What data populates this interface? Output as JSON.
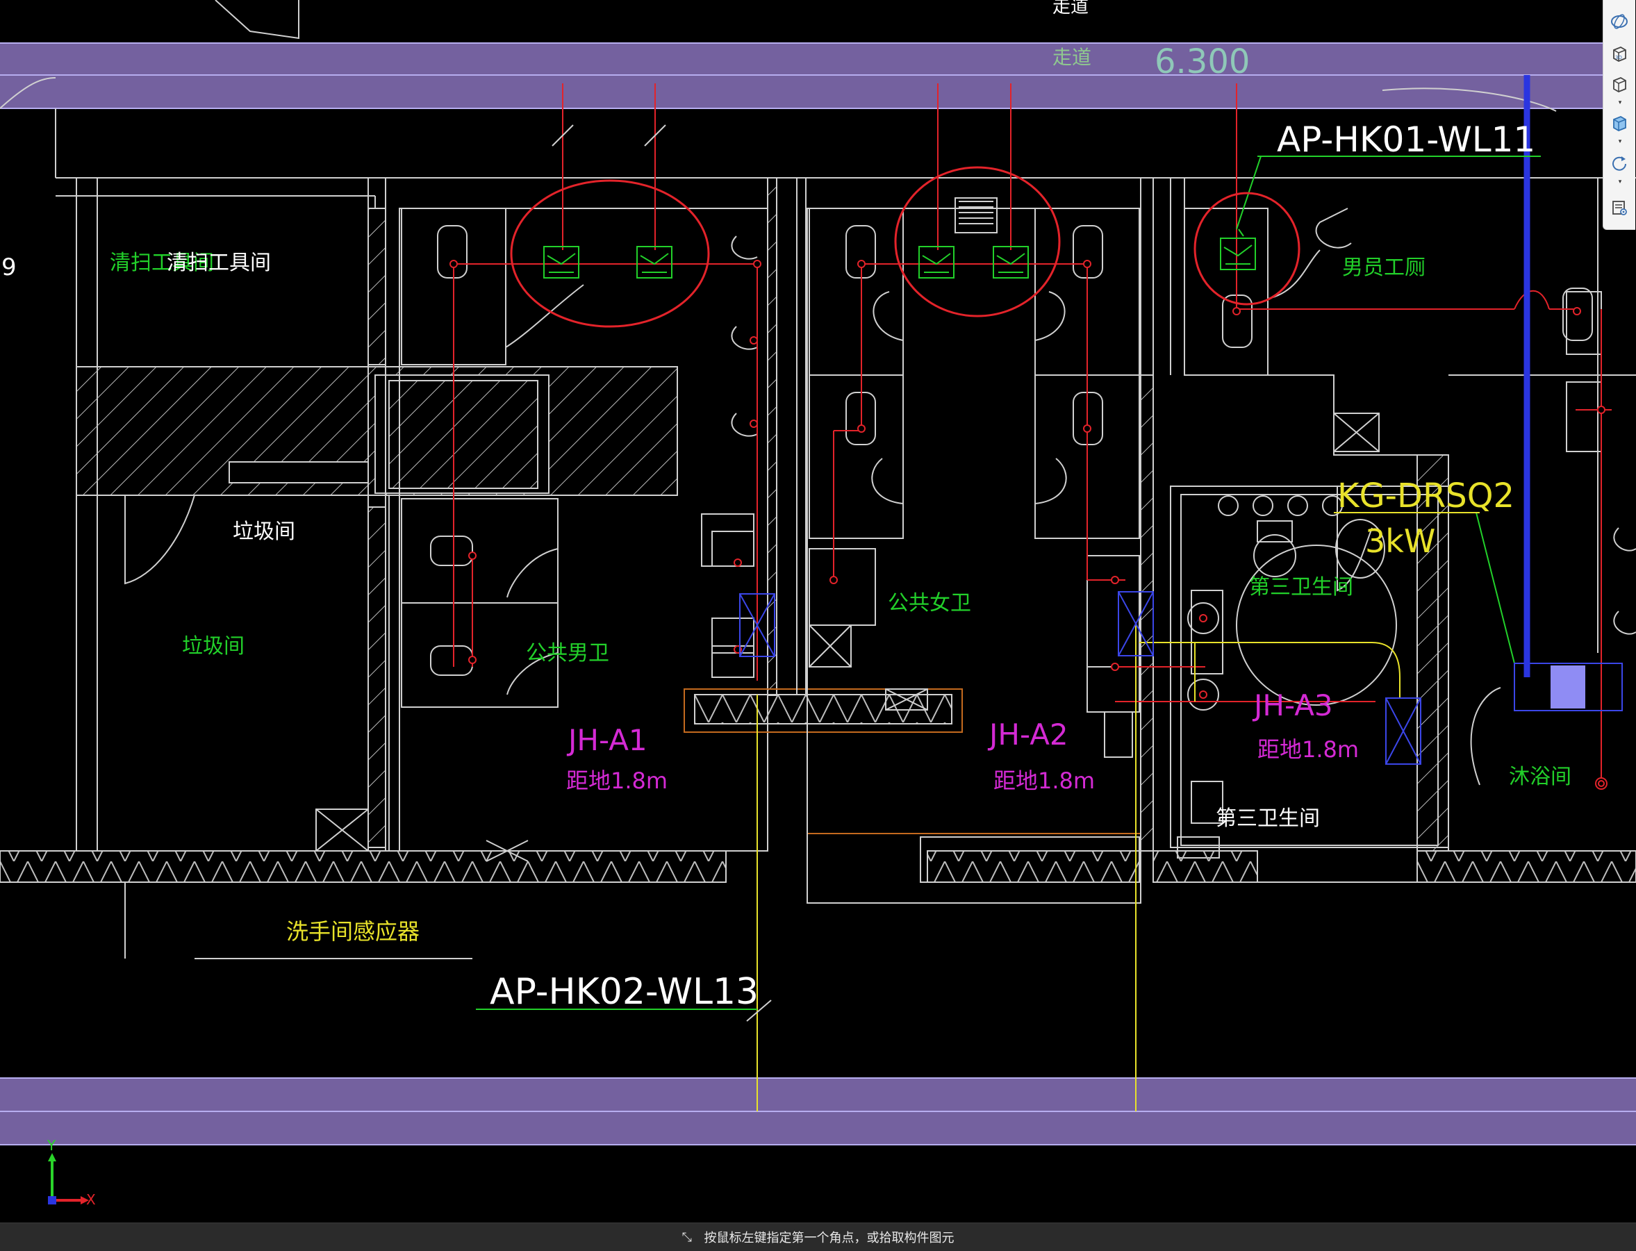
{
  "drawing": {
    "labels": {
      "corridor_top": "走道",
      "corridor": "走道",
      "elevation": "6.300",
      "circuit_top": "AP-HK01-WL11",
      "circuit_bottom": "AP-HK02-WL13",
      "cleaning_room_a": "清扫工具间",
      "cleaning_room_b": "清扫工具间",
      "trash_room_a": "垃圾间",
      "trash_room_b": "垃圾间",
      "male_wc": "公共男卫",
      "female_wc": "公共女卫",
      "staff_wc": "男员工厕",
      "third_wc_a": "第三卫生间",
      "third_wc_b": "第三卫生间",
      "shower": "沐浴间",
      "sensor": "洗手间感应器",
      "heater_id": "KG-DRSQ2",
      "heater_power": "3kW",
      "jh_a1": "JH-A1",
      "jh_a1_h": "距地1.8m",
      "jh_a2": "JH-A2",
      "jh_a2_h": "距地1.8m",
      "jh_a3": "JH-A3",
      "jh_a3_h": "距地1.8m",
      "edge_num": "9"
    },
    "colors": {
      "background": "#000000",
      "wall": "#d0d0d0",
      "band": "#7a66a8",
      "red": "#e3232a",
      "green": "#22d02a",
      "yellow": "#e8e22a",
      "magenta": "#d42ad4",
      "blue": "#2a35e0",
      "orange": "#c46a1e"
    }
  },
  "axis": {
    "x_label": "X",
    "y_label": "Y"
  },
  "status": {
    "prompt": "按鼠标左键指定第一个角点，或拾取构件图元"
  },
  "toolbar": {
    "buttons": [
      {
        "name": "orbit-icon"
      },
      {
        "name": "3d-view-icon"
      },
      {
        "name": "box-view-icon"
      },
      {
        "name": "shaded-box-icon"
      },
      {
        "name": "rotate-icon"
      },
      {
        "name": "layer-visibility-icon"
      }
    ]
  }
}
